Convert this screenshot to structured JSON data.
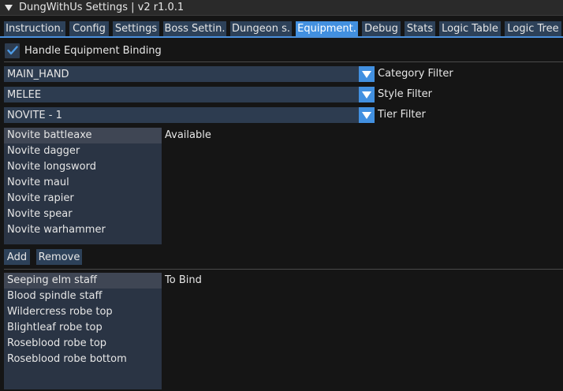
{
  "window": {
    "title": "DungWithUs Settings | v2 r1.0.1"
  },
  "tabs": [
    {
      "label": "Instruction."
    },
    {
      "label": "Config"
    },
    {
      "label": "Settings"
    },
    {
      "label": "Boss Settin."
    },
    {
      "label": "Dungeon s."
    },
    {
      "label": "Equipment.",
      "active": true
    },
    {
      "label": "Debug"
    },
    {
      "label": "Stats"
    },
    {
      "label": "Logic Table"
    },
    {
      "label": "Logic Tree"
    }
  ],
  "binding": {
    "checkbox_label": "Handle Equipment Binding",
    "checked": true
  },
  "filters": {
    "category": {
      "value": "MAIN_HAND",
      "label": "Category Filter"
    },
    "style": {
      "value": "MELEE",
      "label": "Style Filter"
    },
    "tier": {
      "value": "NOVITE - 1",
      "label": "Tier Filter"
    }
  },
  "available": {
    "label": "Available",
    "items": [
      "Novite battleaxe",
      "Novite dagger",
      "Novite longsword",
      "Novite maul",
      "Novite rapier",
      "Novite spear",
      "Novite warhammer"
    ]
  },
  "buttons": {
    "add": "Add",
    "remove": "Remove"
  },
  "to_bind": {
    "label": "To Bind",
    "items": [
      "Seeping elm staff",
      "Blood spindle staff",
      "Wildercress robe top",
      "Blightleaf robe top",
      "Roseblood robe top",
      "Roseblood robe bottom"
    ]
  },
  "colors": {
    "accent": "#4290e0",
    "frame": "#2d3c50",
    "tab": "#2d4159",
    "background": "#151515"
  }
}
